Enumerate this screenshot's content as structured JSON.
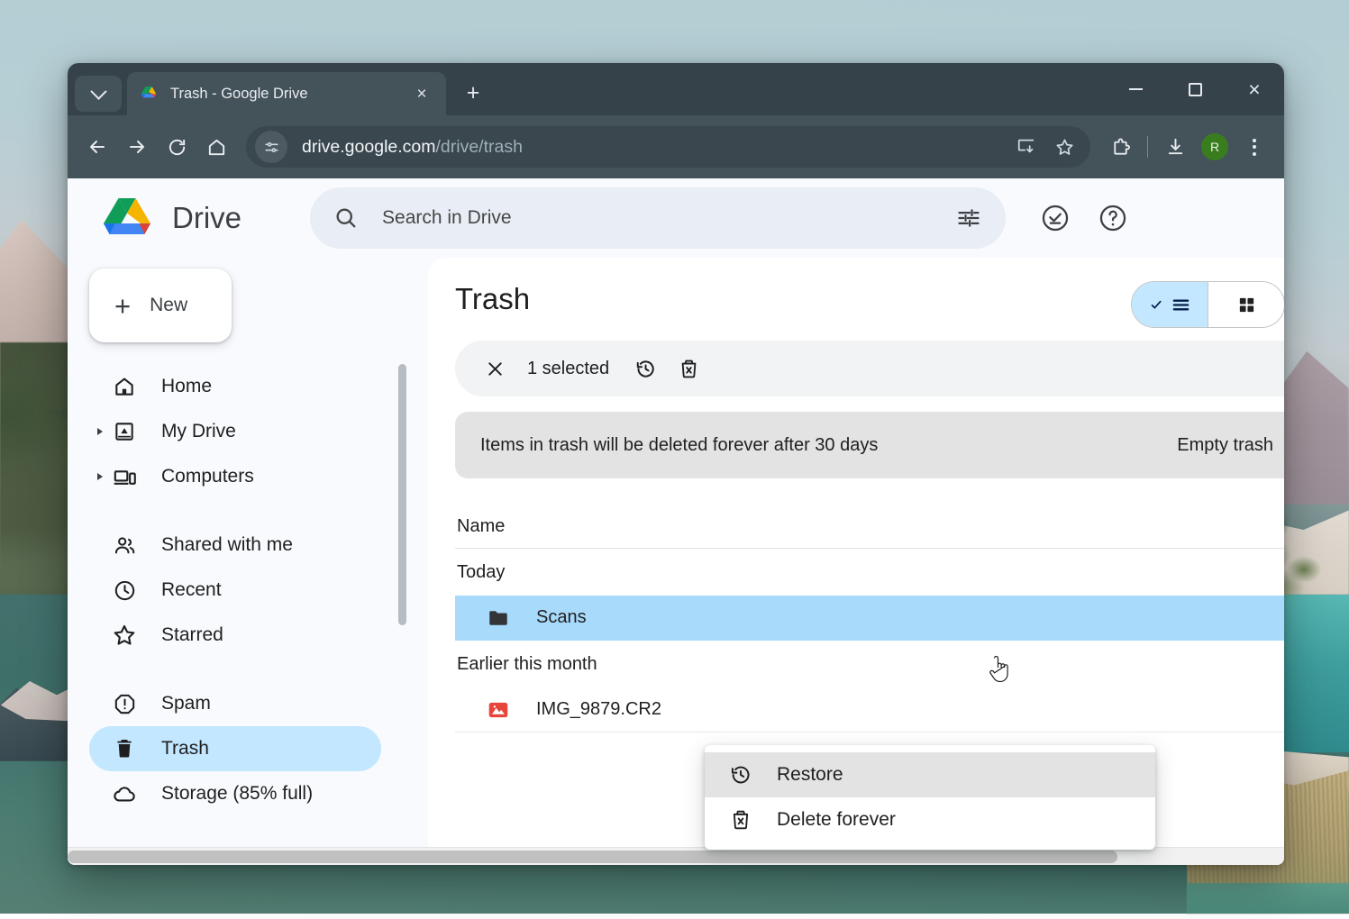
{
  "browser": {
    "tab": {
      "title": "Trash - Google Drive",
      "favicon": "google-drive-icon",
      "close": "×"
    },
    "new_tab_label": "+",
    "tab_search_icon": "chevron-down-icon",
    "window_controls": {
      "minimize": "minimize-icon",
      "maximize": "maximize-icon",
      "close": "×"
    },
    "nav": {
      "back": "back-arrow-icon",
      "forward": "forward-arrow-icon",
      "reload": "reload-icon",
      "home": "home-icon"
    },
    "omnibox": {
      "site_info_icon": "site-settings-icon",
      "url_host": "drive.google.com",
      "url_path": "/drive/trash",
      "install_icon": "install-app-icon",
      "bookmark_icon": "star-icon"
    },
    "actions": {
      "extensions_icon": "extensions-puzzle-icon",
      "downloads_icon": "download-icon",
      "profile_initial": "R",
      "menu_icon": "kebab-menu-icon"
    }
  },
  "app": {
    "logo": "google-drive-logo",
    "name": "Drive",
    "search": {
      "icon": "search-icon",
      "placeholder": "Search in Drive",
      "tune_icon": "tune-filter-icon"
    },
    "header_actions": [
      {
        "name": "activity-icon",
        "glyph": "check-circle"
      },
      {
        "name": "help-icon",
        "glyph": "question-circle"
      }
    ]
  },
  "sidebar": {
    "new_button": {
      "label": "New",
      "icon": "plus-icon"
    },
    "items": [
      {
        "label": "Home",
        "icon": "home-icon",
        "active": false,
        "caret": false
      },
      {
        "label": "My Drive",
        "icon": "my-drive-icon",
        "active": false,
        "caret": true
      },
      {
        "label": "Computers",
        "icon": "computers-icon",
        "active": false,
        "caret": true
      },
      {
        "label": "Shared with me",
        "icon": "people-icon",
        "active": false,
        "caret": false
      },
      {
        "label": "Recent",
        "icon": "clock-icon",
        "active": false,
        "caret": false
      },
      {
        "label": "Starred",
        "icon": "star-icon",
        "active": false,
        "caret": false
      },
      {
        "label": "Spam",
        "icon": "spam-icon",
        "active": false,
        "caret": false
      },
      {
        "label": "Trash",
        "icon": "trash-icon",
        "active": true,
        "caret": false
      },
      {
        "label": "Storage (85% full)",
        "icon": "cloud-icon",
        "active": false,
        "caret": false
      }
    ]
  },
  "main": {
    "title": "Trash",
    "view_toggle": {
      "list": {
        "name": "list-view-icon",
        "active": true
      },
      "grid": {
        "name": "grid-view-icon",
        "active": false
      }
    },
    "selection_bar": {
      "close_icon": "close-icon",
      "count_label": "1 selected",
      "restore_icon": "restore-icon",
      "delete_forever_icon": "delete-forever-icon"
    },
    "banner": {
      "text": "Items in trash will be deleted forever after 30 days",
      "action_label": "Empty trash"
    },
    "columns": [
      "Name"
    ],
    "groups": [
      {
        "label": "Today",
        "rows": [
          {
            "name": "Scans",
            "icon": "folder-icon",
            "selected": true
          }
        ]
      },
      {
        "label": "Earlier this month",
        "rows": [
          {
            "name": "IMG_9879.CR2",
            "icon": "image-file-icon",
            "selected": false
          }
        ]
      }
    ]
  },
  "context_menu": {
    "items": [
      {
        "label": "Restore",
        "icon": "restore-icon",
        "hover": true
      },
      {
        "label": "Delete forever",
        "icon": "delete-forever-icon",
        "hover": false
      }
    ]
  },
  "colors": {
    "accent_blue": "#c2e7ff",
    "selected_row": "#a8dafc",
    "browser_chrome": "#44525a",
    "tabstrip": "#35424a",
    "banner_bg": "#e3e3e3",
    "avatar_green": "#3a7d1f",
    "image_icon_red": "#e8453c"
  }
}
